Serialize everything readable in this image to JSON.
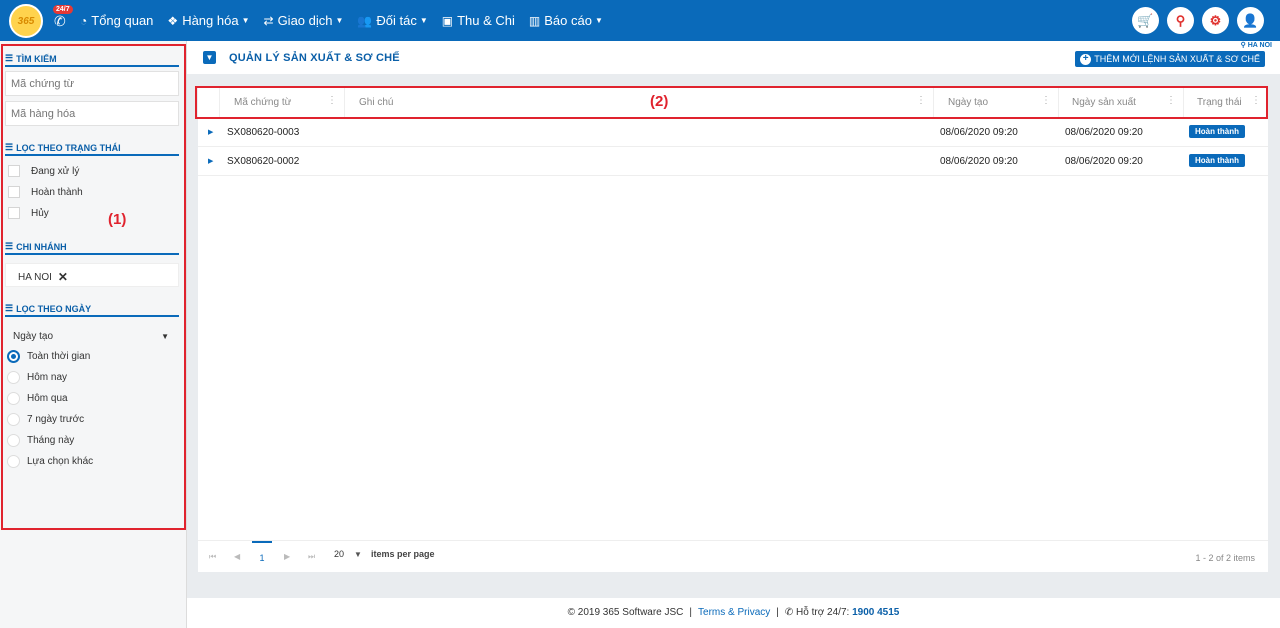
{
  "app": {
    "logo_text": "365",
    "hotline_badge": "24/7"
  },
  "nav": {
    "items": [
      {
        "label": "Tổng quan",
        "icon": "dashboard-icon",
        "caret": false
      },
      {
        "label": "Hàng hóa",
        "icon": "cubes-icon",
        "caret": true
      },
      {
        "label": "Giao dịch",
        "icon": "exchange-icon",
        "caret": true
      },
      {
        "label": "Đối tác",
        "icon": "users-icon",
        "caret": true
      },
      {
        "label": "Thu & Chi",
        "icon": "money-icon",
        "caret": false
      },
      {
        "label": "Báo cáo",
        "icon": "bar-chart-icon",
        "caret": true
      }
    ],
    "right_icons": [
      "cart-icon",
      "location-icon",
      "gear-icon",
      "user-icon"
    ]
  },
  "sidebar": {
    "search": {
      "title": "TÌM KIẾM",
      "voucher_placeholder": "Mã chứng từ",
      "product_placeholder": "Mã hàng hóa"
    },
    "status": {
      "title": "LỌC THEO TRẠNG THÁI",
      "options": [
        "Đang xử lý",
        "Hoàn thành",
        "Hủy"
      ]
    },
    "branch": {
      "title": "CHI NHÁNH",
      "selected": "HA NOI"
    },
    "date": {
      "title": "LỌC THEO NGÀY",
      "field": "Ngày tạo",
      "options": [
        "Toàn thời gian",
        "Hôm nay",
        "Hôm qua",
        "7 ngày trước",
        "Tháng này",
        "Lựa chọn khác"
      ],
      "selected_index": 0
    }
  },
  "annotations": {
    "sidebar": "(1)",
    "header": "(2)"
  },
  "main": {
    "title": "QUẢN LÝ SẢN XUẤT & SƠ CHẾ",
    "branch_badge": "HA NOI",
    "add_button": "THÊM MỚI LỆNH SẢN XUẤT & SƠ CHẾ",
    "columns": [
      "Mã chứng từ",
      "Ghi chú",
      "Ngày tạo",
      "Ngày sản xuất",
      "Trạng thái"
    ],
    "rows": [
      {
        "code": "SX080620-0003",
        "note": "",
        "created": "08/06/2020 09:20",
        "produced": "08/06/2020 09:20",
        "status": "Hoàn thành"
      },
      {
        "code": "SX080620-0002",
        "note": "",
        "created": "08/06/2020 09:20",
        "produced": "08/06/2020 09:20",
        "status": "Hoàn thành"
      }
    ],
    "pager": {
      "current_page": "1",
      "page_size": "20",
      "page_size_label": "items per page",
      "info": "1 - 2 of 2 items"
    }
  },
  "footer": {
    "copyright": "© 2019 365 Software JSC",
    "terms": "Terms & Privacy",
    "support_label": "Hỗ trợ 24/7:",
    "hotline": "1900 4515"
  }
}
